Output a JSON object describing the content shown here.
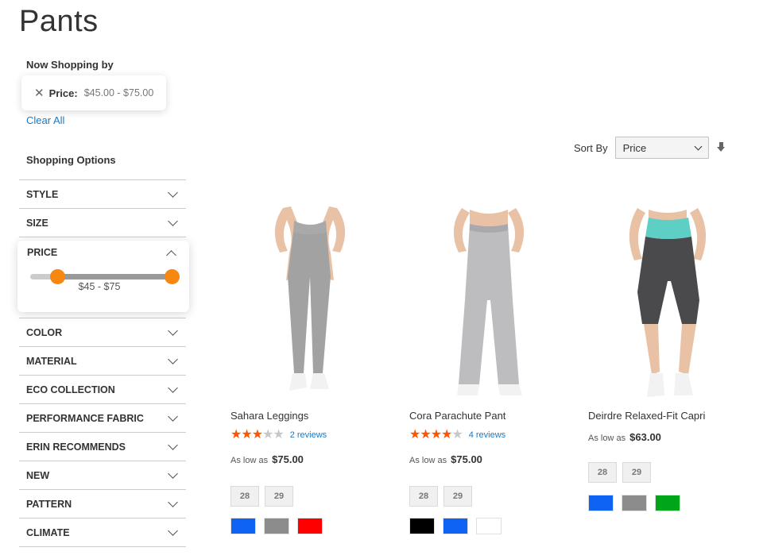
{
  "page": {
    "title": "Pants"
  },
  "state": {
    "heading": "Now Shopping by",
    "filter_label": "Price:",
    "filter_value": "$45.00 - $75.00",
    "clear_all": "Clear All"
  },
  "sidebar": {
    "heading": "Shopping Options",
    "filters": [
      "STYLE",
      "SIZE",
      "PRICE",
      "COLOR",
      "MATERIAL",
      "ECO COLLECTION",
      "PERFORMANCE FABRIC",
      "ERIN RECOMMENDS",
      "NEW",
      "PATTERN",
      "CLIMATE"
    ],
    "price_filter": {
      "label": "PRICE",
      "range_text": "$45 - $75",
      "handle_min_fraction": 0.19,
      "handle_max_fraction": 1.0
    }
  },
  "toolbar": {
    "sort_label": "Sort By",
    "sort_value": "Price"
  },
  "colors": {
    "accent": "#f7870e",
    "link": "#1979c3",
    "star_on": "#ff5501",
    "star_off": "#c7c7c7"
  },
  "products": [
    {
      "name": "Sahara Leggings",
      "rating_stars": 3,
      "reviews": "2 reviews",
      "price_prefix": "As low as",
      "price": "$75.00",
      "sizes": [
        "28",
        "29"
      ],
      "swatches": [
        "#0e63f5",
        "#8c8c8c",
        "#ff0000"
      ]
    },
    {
      "name": "Cora Parachute Pant",
      "rating_stars": 4,
      "reviews": "4 reviews",
      "price_prefix": "As low as",
      "price": "$75.00",
      "sizes": [
        "28",
        "29"
      ],
      "swatches": [
        "#000000",
        "#0e63f5",
        "#ffffff"
      ]
    },
    {
      "name": "Deirdre Relaxed-Fit Capri",
      "rating_stars": null,
      "reviews": "",
      "price_prefix": "As low as",
      "price": "$63.00",
      "sizes": [
        "28",
        "29"
      ],
      "swatches": [
        "#0e63f5",
        "#8c8c8c",
        "#00a51a"
      ]
    }
  ]
}
